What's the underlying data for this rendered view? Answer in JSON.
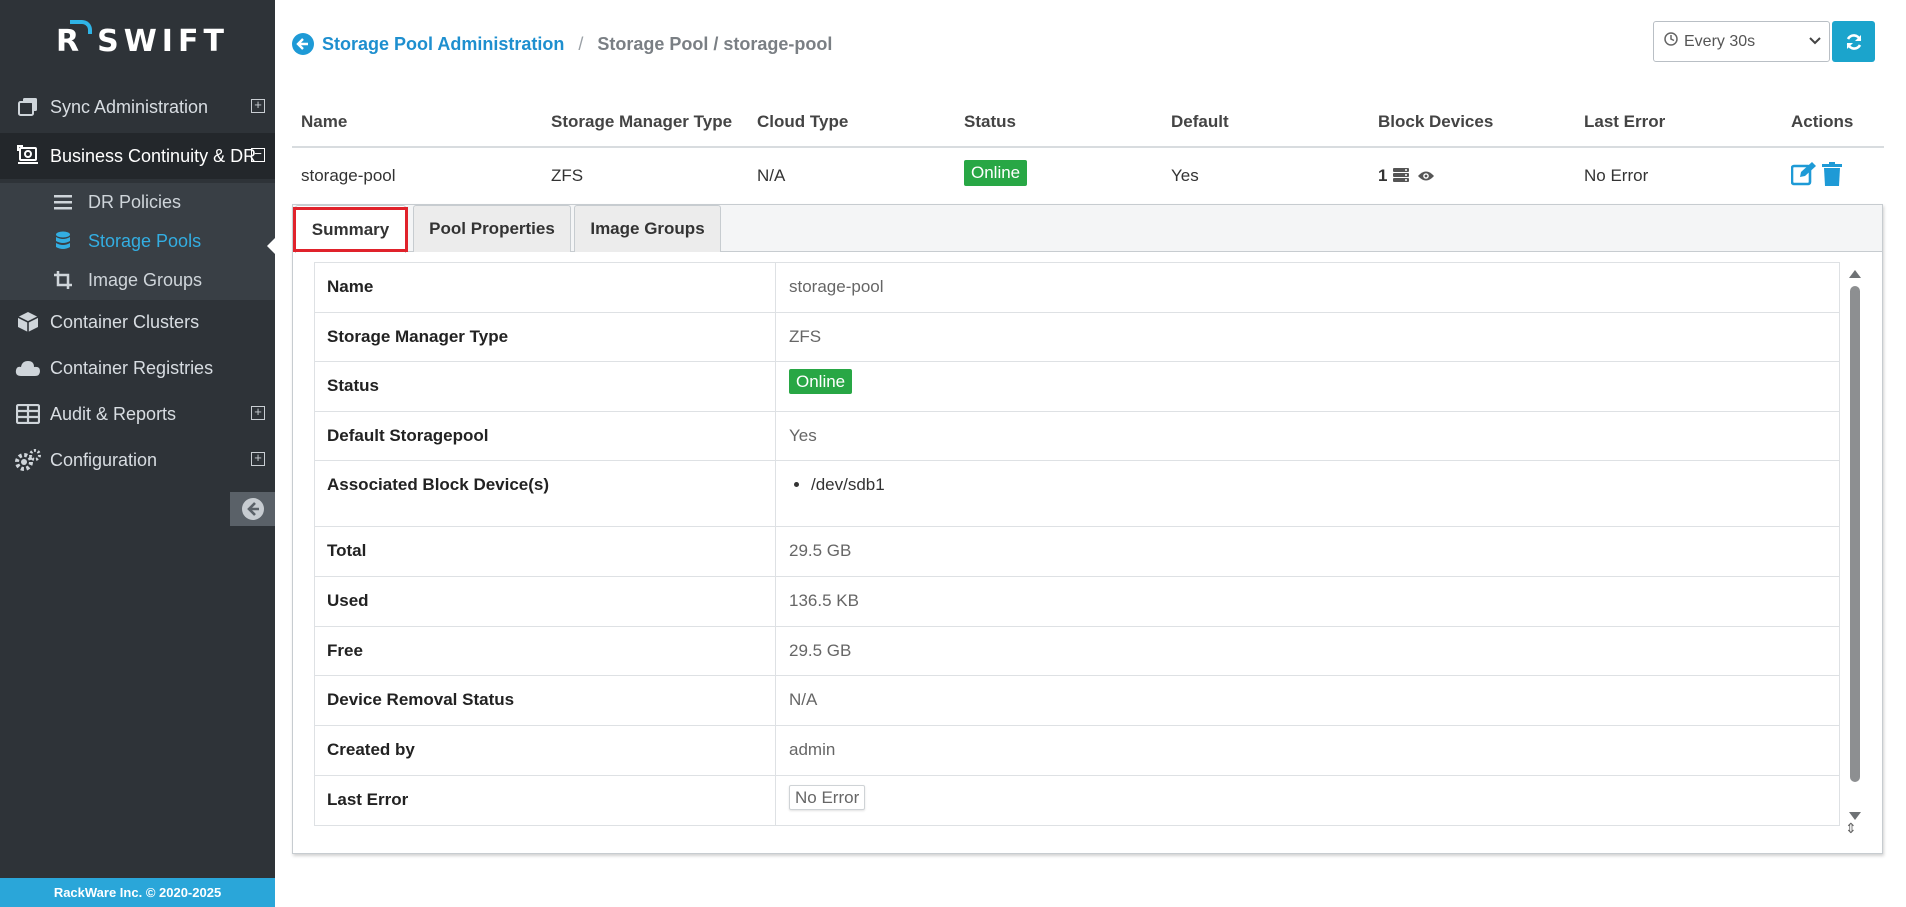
{
  "brand": {
    "logo_letter": "R",
    "logo_word": "SWIFT"
  },
  "sidebar": {
    "items": [
      {
        "label": "Sync Administration",
        "icon": "copy-icon",
        "expandable": true
      },
      {
        "label": "Business Continuity & DR",
        "icon": "dr-icon",
        "expandable": true,
        "expanded": true
      },
      {
        "label": "Container Clusters",
        "icon": "cube-icon"
      },
      {
        "label": "Container Registries",
        "icon": "cloud-icon"
      },
      {
        "label": "Audit & Reports",
        "icon": "table-icon",
        "expandable": true
      },
      {
        "label": "Configuration",
        "icon": "gears-icon",
        "expandable": true
      }
    ],
    "sub_items": [
      {
        "label": "DR Policies",
        "icon": "list-icon"
      },
      {
        "label": "Storage Pools",
        "icon": "database-icon",
        "selected": true
      },
      {
        "label": "Image Groups",
        "icon": "crop-icon"
      }
    ],
    "footer": "RackWare Inc. © 2020-2025"
  },
  "breadcrumb": {
    "link": "Storage Pool Administration",
    "separator": "/",
    "current": "Storage Pool / storage-pool"
  },
  "refresh": {
    "interval": "Every 30s"
  },
  "table": {
    "headers": [
      "Name",
      "Storage Manager Type",
      "Cloud Type",
      "Status",
      "Default",
      "Block Devices",
      "Last Error",
      "Actions"
    ],
    "row": {
      "name": "storage-pool",
      "manager_type": "ZFS",
      "cloud_type": "N/A",
      "status": "Online",
      "default": "Yes",
      "block_devices": "1",
      "last_error": "No Error"
    }
  },
  "tabs": [
    "Summary",
    "Pool Properties",
    "Image Groups"
  ],
  "summary": {
    "name_label": "Name",
    "name": "storage-pool",
    "type_label": "Storage Manager Type",
    "type": "ZFS",
    "status_label": "Status",
    "status": "Online",
    "default_label": "Default Storagepool",
    "default": "Yes",
    "devices_label": "Associated Block Device(s)",
    "devices": [
      "/dev/sdb1"
    ],
    "total_label": "Total",
    "total": "29.5 GB",
    "used_label": "Used",
    "used": "136.5 KB",
    "free_label": "Free",
    "free": "29.5 GB",
    "removal_label": "Device Removal Status",
    "removal": "N/A",
    "created_label": "Created by",
    "created": "admin",
    "error_label": "Last Error",
    "error": "No Error"
  },
  "colors": {
    "accent": "#1e9ad6",
    "online": "#28a745",
    "sidebar": "#2e3338",
    "highlight": "#e0222b"
  }
}
